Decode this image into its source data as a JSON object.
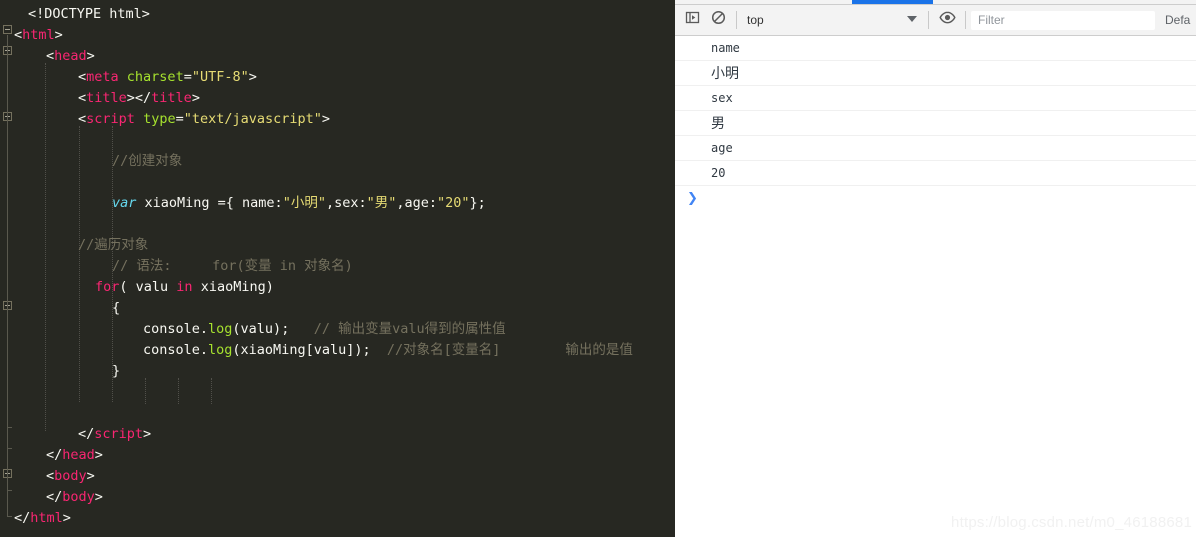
{
  "editor": {
    "language": "html",
    "theme_background": "#272822",
    "lines": [
      {
        "indent": 28,
        "segments": [
          {
            "t": "<!DOCTYPE html>",
            "c": "plain"
          }
        ]
      },
      {
        "indent": 14,
        "segments": [
          {
            "t": "<",
            "c": "brack"
          },
          {
            "t": "html",
            "c": "tagname"
          },
          {
            "t": ">",
            "c": "brack"
          }
        ]
      },
      {
        "indent": 46,
        "segments": [
          {
            "t": "<",
            "c": "brack"
          },
          {
            "t": "head",
            "c": "tagname"
          },
          {
            "t": ">",
            "c": "brack"
          }
        ]
      },
      {
        "indent": 78,
        "segments": [
          {
            "t": "<",
            "c": "brack"
          },
          {
            "t": "meta",
            "c": "tagname"
          },
          {
            "t": " ",
            "c": "plain"
          },
          {
            "t": "charset",
            "c": "attr"
          },
          {
            "t": "=",
            "c": "plain"
          },
          {
            "t": "\"UTF-8\"",
            "c": "str"
          },
          {
            "t": ">",
            "c": "brack"
          }
        ]
      },
      {
        "indent": 78,
        "segments": [
          {
            "t": "<",
            "c": "brack"
          },
          {
            "t": "title",
            "c": "tagname"
          },
          {
            "t": "></",
            "c": "brack"
          },
          {
            "t": "title",
            "c": "tagname"
          },
          {
            "t": ">",
            "c": "brack"
          }
        ]
      },
      {
        "indent": 78,
        "segments": [
          {
            "t": "<",
            "c": "brack"
          },
          {
            "t": "script",
            "c": "tagname"
          },
          {
            "t": " ",
            "c": "plain"
          },
          {
            "t": "type",
            "c": "attr"
          },
          {
            "t": "=",
            "c": "plain"
          },
          {
            "t": "\"text/javascript\"",
            "c": "str"
          },
          {
            "t": ">",
            "c": "brack"
          }
        ]
      },
      {
        "indent": 0,
        "segments": []
      },
      {
        "indent": 112,
        "segments": [
          {
            "t": "//创建对象",
            "c": "com"
          }
        ]
      },
      {
        "indent": 0,
        "segments": []
      },
      {
        "indent": 112,
        "segments": [
          {
            "t": "var",
            "c": "kwv"
          },
          {
            "t": " xiaoMing ={ name:",
            "c": "plain"
          },
          {
            "t": "\"小明\"",
            "c": "str"
          },
          {
            "t": ",sex:",
            "c": "plain"
          },
          {
            "t": "\"男\"",
            "c": "str"
          },
          {
            "t": ",age:",
            "c": "plain"
          },
          {
            "t": "\"20\"",
            "c": "str"
          },
          {
            "t": "};",
            "c": "plain"
          }
        ]
      },
      {
        "indent": 0,
        "segments": []
      },
      {
        "indent": 78,
        "segments": [
          {
            "t": "//遍历对象",
            "c": "com"
          }
        ]
      },
      {
        "indent": 112,
        "segments": [
          {
            "t": "// 语法:     for(变量 in 对象名)",
            "c": "com"
          }
        ]
      },
      {
        "indent": 95,
        "segments": [
          {
            "t": "for",
            "c": "kw"
          },
          {
            "t": "( valu ",
            "c": "plain"
          },
          {
            "t": "in",
            "c": "kw"
          },
          {
            "t": " xiaoMing)",
            "c": "plain"
          }
        ]
      },
      {
        "indent": 112,
        "segments": [
          {
            "t": "{",
            "c": "plain"
          }
        ]
      },
      {
        "indent": 143,
        "segments": [
          {
            "t": "console.",
            "c": "plain"
          },
          {
            "t": "log",
            "c": "fn"
          },
          {
            "t": "(valu);",
            "c": "plain"
          },
          {
            "t": "   // 输出变量valu得到的属性值",
            "c": "com"
          }
        ]
      },
      {
        "indent": 143,
        "segments": [
          {
            "t": "console.",
            "c": "plain"
          },
          {
            "t": "log",
            "c": "fn"
          },
          {
            "t": "(xiaoMing[valu]);",
            "c": "plain"
          },
          {
            "t": "  //对象名[变量名]        输出的是值",
            "c": "com"
          }
        ]
      },
      {
        "indent": 112,
        "segments": [
          {
            "t": "}",
            "c": "plain"
          }
        ]
      },
      {
        "indent": 0,
        "segments": []
      },
      {
        "indent": 0,
        "segments": []
      },
      {
        "indent": 78,
        "segments": [
          {
            "t": "</",
            "c": "brack"
          },
          {
            "t": "script",
            "c": "tagname"
          },
          {
            "t": ">",
            "c": "brack"
          }
        ]
      },
      {
        "indent": 46,
        "segments": [
          {
            "t": "</",
            "c": "brack"
          },
          {
            "t": "head",
            "c": "tagname"
          },
          {
            "t": ">",
            "c": "brack"
          }
        ]
      },
      {
        "indent": 46,
        "segments": [
          {
            "t": "<",
            "c": "brack"
          },
          {
            "t": "body",
            "c": "tagname"
          },
          {
            "t": ">",
            "c": "brack"
          }
        ]
      },
      {
        "indent": 46,
        "segments": [
          {
            "t": "</",
            "c": "brack"
          },
          {
            "t": "body",
            "c": "tagname"
          },
          {
            "t": ">",
            "c": "brack"
          }
        ]
      },
      {
        "indent": 14,
        "segments": [
          {
            "t": "</",
            "c": "brack"
          },
          {
            "t": "html",
            "c": "tagname"
          },
          {
            "t": ">",
            "c": "brack"
          }
        ]
      }
    ]
  },
  "devtools": {
    "active_tab_accent": "#1a73e8",
    "toolbar": {
      "sidebar_toggle_icon": "console-sidebar-icon",
      "clear_console_icon": "clear-console-icon",
      "context_selected": "top",
      "context_dropdown_icon": "chevron-down-icon",
      "eye_icon": "live-expression-eye-icon",
      "filter_placeholder": "Filter",
      "levels_label": "Defa"
    },
    "console_rows": [
      {
        "text": "name",
        "cjk": false
      },
      {
        "text": "小明",
        "cjk": true
      },
      {
        "text": "sex",
        "cjk": false
      },
      {
        "text": "男",
        "cjk": true
      },
      {
        "text": "age",
        "cjk": false
      },
      {
        "text": "20",
        "cjk": false
      }
    ],
    "prompt_symbol": "❯"
  },
  "watermark": {
    "text": "https://blog.csdn.net/m0_46188681"
  }
}
